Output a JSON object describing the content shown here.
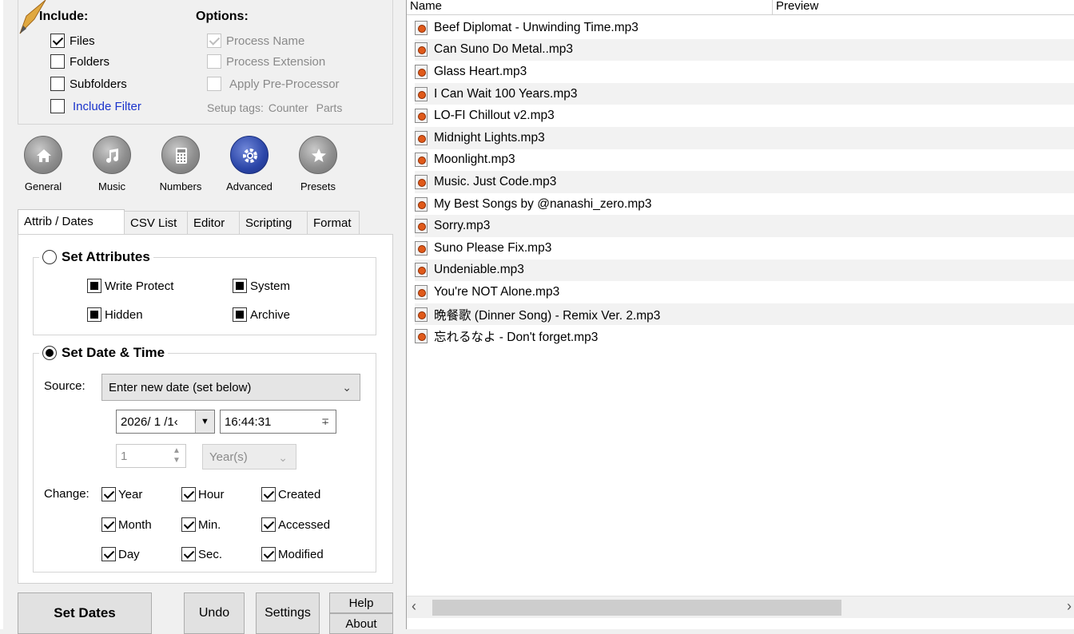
{
  "include": {
    "header": "Include:",
    "files": "Files",
    "folders": "Folders",
    "subfolders": "Subfolders",
    "include_filter": "Include Filter"
  },
  "options": {
    "header": "Options:",
    "process_name": "Process Name",
    "process_extension": "Process Extension",
    "apply_pre_processor": "Apply Pre-Processor",
    "setup_tags": "Setup tags:",
    "counter": "Counter",
    "parts": "Parts"
  },
  "toolbar": {
    "general": "General",
    "music": "Music",
    "numbers": "Numbers",
    "advanced": "Advanced",
    "presets": "Presets"
  },
  "tabs": [
    "Attrib / Dates",
    "CSV List",
    "Editor",
    "Scripting",
    "Format"
  ],
  "attributes": {
    "title": "Set Attributes",
    "write_protect": "Write Protect",
    "system": "System",
    "hidden": "Hidden",
    "archive": "Archive"
  },
  "datetime": {
    "title": "Set Date & Time",
    "source_label": "Source:",
    "source_value": "Enter new date (set below)",
    "date_value": "2026/ 1 /1‹",
    "time_value": "16:44:31",
    "offset_value": "1",
    "unit_value": "Year(s)",
    "change_label": "Change:",
    "year": "Year",
    "hour": "Hour",
    "created": "Created",
    "month": "Month",
    "min": "Min.",
    "accessed": "Accessed",
    "day": "Day",
    "sec": "Sec.",
    "modified": "Modified"
  },
  "buttons": {
    "set_dates": "Set Dates",
    "undo": "Undo",
    "settings": "Settings",
    "help": "Help",
    "about": "About"
  },
  "list": {
    "col_name": "Name",
    "col_preview": "Preview",
    "files": [
      "Beef Diplomat - Unwinding Time.mp3",
      "Can Suno Do Metal..mp3",
      "Glass Heart.mp3",
      "I Can Wait 100 Years.mp3",
      "LO-FI Chillout v2.mp3",
      "Midnight Lights.mp3",
      "Moonlight.mp3",
      "Music. Just Code.mp3",
      "My Best Songs by @nanashi_zero.mp3",
      "Sorry.mp3",
      "Suno Please Fix.mp3",
      "Undeniable.mp3",
      "You're NOT Alone.mp3",
      "晩餐歌 (Dinner Song) - Remix Ver. 2.mp3",
      "忘れるなよ - Don't forget.mp3"
    ]
  }
}
